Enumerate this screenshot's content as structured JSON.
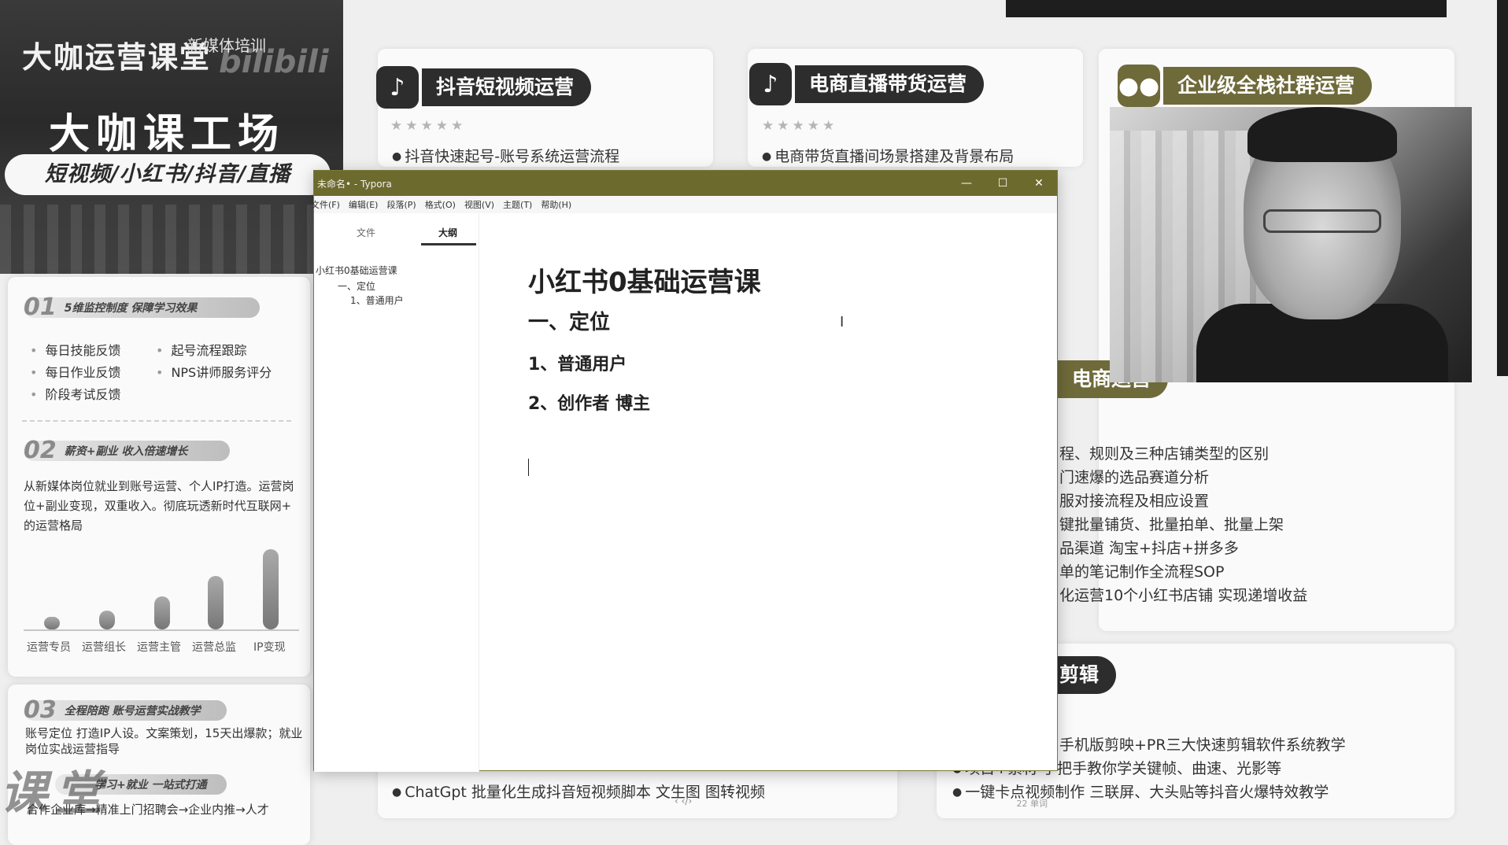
{
  "banner": {
    "brand": "大咖运营课堂",
    "brand_small": "新媒体培训",
    "watermark": "bilibili",
    "title": "大咖课工场",
    "tags": "短视频/小红书/抖音/直播"
  },
  "left_card": {
    "sec1": {
      "num": "01",
      "title": "5维监控制度 保障学习效果",
      "items": [
        "每日技能反馈",
        "起号流程跟踪",
        "每日作业反馈",
        "NPS讲师服务评分",
        "阶段考试反馈"
      ]
    },
    "sec2": {
      "num": "02",
      "title": "薪资+副业 收入倍速增长",
      "para": "从新媒体岗位就业到账号运营、个人IP打造。运营岗位+副业变现，双重收入。彻底玩透新时代互联网+ 的运营格局",
      "chart_labels": [
        "运营专员",
        "运营组长",
        "运营主管",
        "运营总监",
        "IP变现"
      ]
    },
    "sec3": {
      "num": "03",
      "title": "全程陪跑 账号运营实战教学",
      "text": "账号定位 打造IP人设。文案策划，15天出爆款；就业岗位实战运营指导"
    },
    "sec4": {
      "title": "学习+就业 一站式打通",
      "text": "合作企业库→精准上门招聘会→企业内推→人才"
    },
    "watermark": "课堂"
  },
  "courses": {
    "douyin": {
      "title": "抖音短视频运营",
      "stars": "★★★★★",
      "line1": "抖音快速起号-账号系统运营流程",
      "bottom_line": "ChatGpt 批量化生成抖音短视频脚本 文生图 图转视频"
    },
    "ecom_live": {
      "title": "电商直播带货运营",
      "stars": "★★★★★",
      "line1": "电商带货直播间场景搭建及背景布局"
    },
    "community": {
      "title": "企业级全栈社群运营"
    },
    "ecom_partial": {
      "title": "电商运营",
      "lines": [
        "程、规则及三种店铺类型的区别",
        "门速爆的选品赛道分析",
        "服对接流程及相应设置",
        "键批量铺货、批量拍单、批量上架",
        "品渠道 淘宝+抖店+拼多多",
        "单的笔记制作全流程SOP",
        "化运营10个小红书店铺 实现递增收益"
      ]
    },
    "edit_partial": {
      "title": "剪辑",
      "lines": [
        "手机版剪映+PR三大快速剪辑软件系统教学",
        "项目+素材 手把手教你学关键帧、曲速、光影等",
        "一键卡点视频制作 三联屏、大头贴等抖音火爆特效教学"
      ]
    }
  },
  "typora": {
    "window_title": "未命名• - Typora",
    "menu": [
      "文件(F)",
      "编辑(E)",
      "段落(P)",
      "格式(O)",
      "视图(V)",
      "主题(T)",
      "帮助(H)"
    ],
    "sidebar_tabs": [
      "文件",
      "大纲"
    ],
    "outline": [
      "小红书0基础运营课",
      "一、定位",
      "1、普通用户"
    ],
    "doc": {
      "h1": "小红书0基础运营课",
      "h2": "一、定位",
      "h3a": "1、普通用户",
      "h3b": "2、创作者 博主"
    },
    "nav_symbols": "‹   ‹/›",
    "word_count": "22 单词"
  }
}
